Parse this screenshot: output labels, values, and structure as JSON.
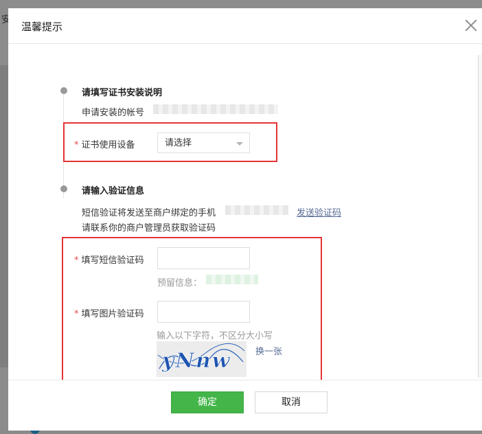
{
  "background": {
    "partial_text": "安"
  },
  "dialog": {
    "title": "温馨提示",
    "step1": {
      "title": "请填写证书安装说明",
      "account_label": "申请安装的帐号",
      "device_label": "证书使用设备",
      "required_mark": "*",
      "device_select_value": "请选择"
    },
    "step2": {
      "title": "请输入验证信息",
      "sms_notice": "短信验证将发送至商户绑定的手机",
      "send_code_link": "发送验证码",
      "contact_notice": "请联系你的商户管理员获取验证码",
      "sms_code_label": "填写短信验证码",
      "sms_code_value": "",
      "reserved_info_label": "预留信息：",
      "image_code_label": "填写图片验证码",
      "image_code_value": "",
      "image_code_hint": "输入以下字符，不区分大小写",
      "captcha_text": "yNnw",
      "refresh_captcha": "换一张"
    },
    "footer": {
      "confirm_label": "确定",
      "cancel_label": "取消"
    }
  },
  "colors": {
    "primary": "#44b549",
    "link": "#576b95",
    "highlight_box": "#e53333",
    "required": "#e64b4b"
  }
}
